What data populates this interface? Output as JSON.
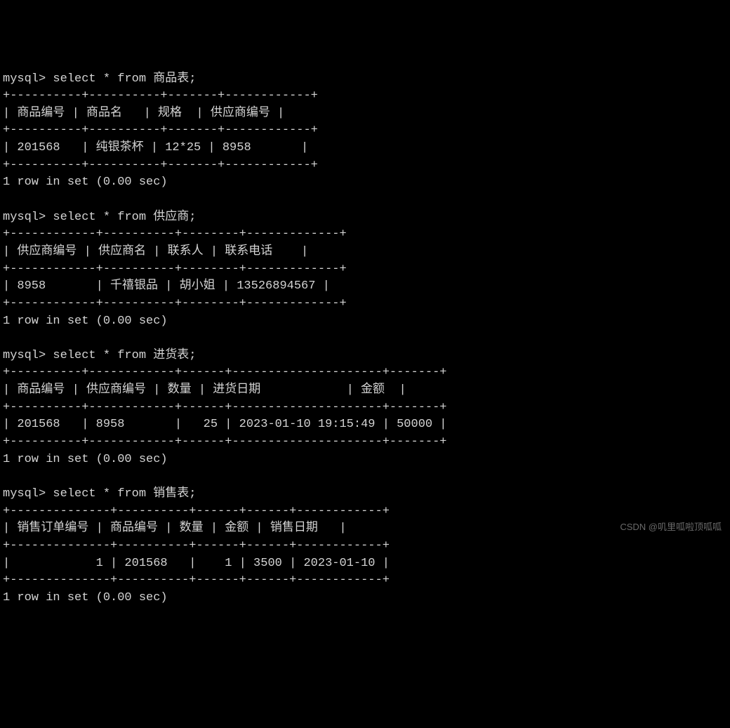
{
  "prompt": "mysql>",
  "queries": [
    {
      "command": "select * from 商品表;",
      "separator": "+----------+----------+-------+------------+",
      "header": "| 商品编号 | 商品名   | 规格  | 供应商编号 |",
      "rows": [
        "| 201568   | 纯银茶杯 | 12*25 | 8958       |"
      ],
      "footer": "1 row in set (0.00 sec)"
    },
    {
      "command": "select * from 供应商;",
      "separator": "+------------+----------+--------+-------------+",
      "header": "| 供应商编号 | 供应商名 | 联系人 | 联系电话    |",
      "rows": [
        "| 8958       | 千禧银品 | 胡小姐 | 13526894567 |"
      ],
      "footer": "1 row in set (0.00 sec)"
    },
    {
      "command": "select * from 进货表;",
      "separator": "+----------+------------+------+---------------------+-------+",
      "header": "| 商品编号 | 供应商编号 | 数量 | 进货日期            | 金额  |",
      "rows": [
        "| 201568   | 8958       |   25 | 2023-01-10 19:15:49 | 50000 |"
      ],
      "footer": "1 row in set (0.00 sec)"
    },
    {
      "command": "select * from 销售表;",
      "separator": "+--------------+----------+------+------+------------+",
      "header": "| 销售订单编号 | 商品编号 | 数量 | 金额 | 销售日期   |",
      "rows": [
        "|            1 | 201568   |    1 | 3500 | 2023-01-10 |"
      ],
      "footer": "1 row in set (0.00 sec)"
    }
  ],
  "watermark": "CSDN @叽里呱啦顶呱呱"
}
